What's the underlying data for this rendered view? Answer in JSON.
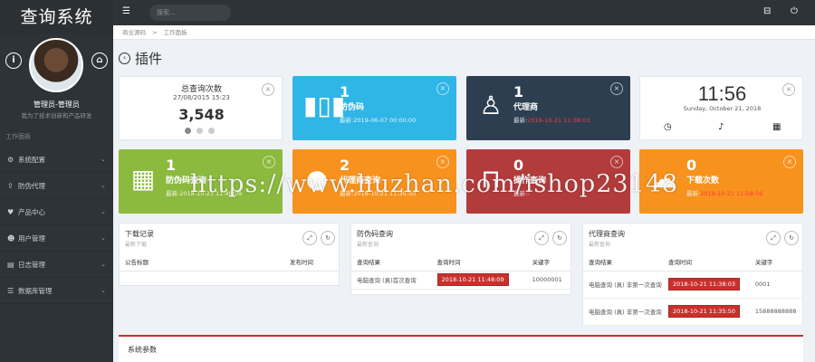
{
  "app": {
    "title": "查询系统"
  },
  "sidebar": {
    "user_name": "管理员-管理员",
    "user_sub": "我为了技术创新和产品研发",
    "section_label": "工作面板",
    "items": [
      {
        "label": "系统配置",
        "icon": "gear-icon"
      },
      {
        "label": "防伪代理",
        "icon": "upload-icon"
      },
      {
        "label": "产品中心",
        "icon": "heart-icon"
      },
      {
        "label": "用户管理",
        "icon": "users-icon"
      },
      {
        "label": "日志管理",
        "icon": "log-icon"
      },
      {
        "label": "数据库管理",
        "icon": "database-icon"
      }
    ]
  },
  "topbar": {
    "search_placeholder": "搜索..."
  },
  "breadcrumb": {
    "home": "商业源码",
    "sep": ">",
    "current": "工作面板"
  },
  "page": {
    "title": "插件"
  },
  "summary": {
    "title": "总查询次数",
    "date": "27/08/2015 15:23",
    "count": "3,548"
  },
  "cards": [
    {
      "number": "1",
      "label": "防伪码",
      "foot_prefix": "最新:",
      "foot": "2019-06-07 00:00:00",
      "color": "#2fb5e6",
      "red_foot": false
    },
    {
      "number": "1",
      "label": "代理商",
      "foot_prefix": "最新:",
      "foot": "2018-10-21 11:38:03",
      "color": "#2c3e50",
      "red_foot": true
    },
    {
      "number": "1",
      "label": "防伪码查询",
      "foot_prefix": "最新:",
      "foot": "2018-10-21 11:48:09",
      "color": "#8bba3e",
      "red_foot": false
    },
    {
      "number": "2",
      "label": "代理商查询",
      "foot_prefix": "最新:",
      "foot": "2018-10-21 11:35:50",
      "color": "#f7921e",
      "red_foot": false
    },
    {
      "number": "0",
      "label": "操作查询",
      "foot_prefix": "最新:",
      "foot": "-",
      "color": "#b23b3b",
      "red_foot": false
    },
    {
      "number": "0",
      "label": "下载次数",
      "foot_prefix": "最新:",
      "foot": "2018-10-21 11:58:56",
      "color": "#f7921e",
      "red_foot": true
    }
  ],
  "clock": {
    "time": "11:56",
    "date": "Sunday, October 21, 2018"
  },
  "panels": {
    "downloads": {
      "title": "下载记录",
      "subtitle": "最新下载",
      "headers": [
        "公告标题",
        "发布时间"
      ],
      "rows": []
    },
    "code_query": {
      "title": "防伪码查询",
      "subtitle": "最新查询",
      "headers": [
        "查询结果",
        "查询时间",
        "关键字"
      ],
      "rows": [
        {
          "result": "电脑查询 (真)首次查询",
          "time": "2018-10-21 11:48:09",
          "key": "10000001"
        }
      ]
    },
    "agent_query": {
      "title": "代理商查询",
      "subtitle": "最新查询",
      "headers": [
        "查询结果",
        "查询时间",
        "关键字"
      ],
      "rows": [
        {
          "result": "电脑查询 (真) 非第一次查询",
          "time": "2018-10-21 11:38:03",
          "key": "0001"
        },
        {
          "result": "电脑查询 (真) 非第一次查询",
          "time": "2018-10-21 11:35:50",
          "key": "15888888888"
        }
      ]
    }
  },
  "system": {
    "title": "系统参数"
  },
  "watermark": "https://www.huzhan.com/ishop23148"
}
